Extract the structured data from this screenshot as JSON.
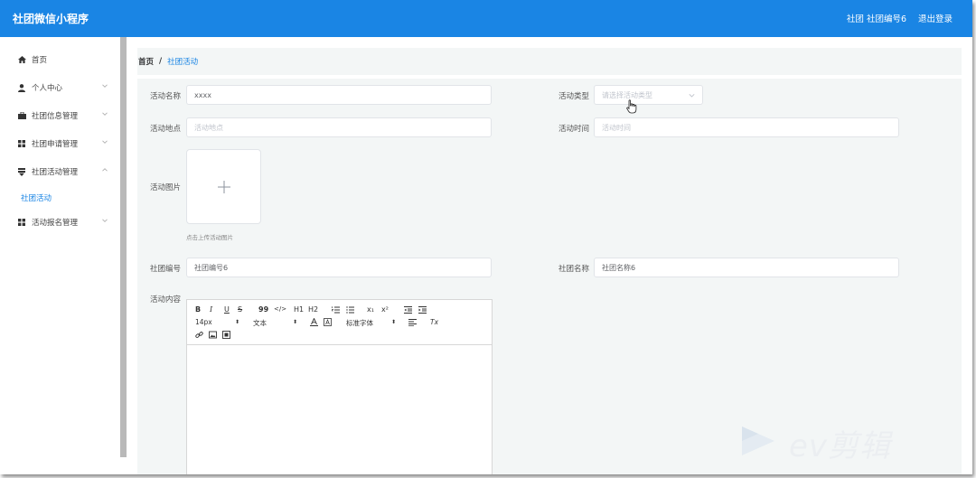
{
  "header": {
    "app_title": "社团微信小程序",
    "user_text": "社团 社团编号6",
    "logout_label": "退出登录"
  },
  "sidebar": {
    "items": [
      {
        "label": "首页",
        "icon": "home-icon",
        "has_chevron": false
      },
      {
        "label": "个人中心",
        "icon": "user-icon",
        "has_chevron": true
      },
      {
        "label": "社团信息管理",
        "icon": "briefcase-icon",
        "has_chevron": true
      },
      {
        "label": "社团申请管理",
        "icon": "grid-icon",
        "has_chevron": true
      },
      {
        "label": "社团活动管理",
        "icon": "funnel-icon",
        "has_chevron": true
      },
      {
        "label": "活动报名管理",
        "icon": "grid-icon",
        "has_chevron": true
      }
    ],
    "sub_item": "社团活动"
  },
  "breadcrumb": {
    "home": "首页",
    "separator": "/",
    "current": "社团活动"
  },
  "form": {
    "name_label": "活动名称",
    "name_value": "xxxx",
    "type_label": "活动类型",
    "type_placeholder": "请选择活动类型",
    "place_label": "活动地点",
    "place_placeholder": "活动地点",
    "time_label": "活动时间",
    "time_placeholder": "活动时间",
    "image_label": "活动图片",
    "upload_hint": "点击上传活动图片",
    "club_no_label": "社团编号",
    "club_no_value": "社团编号6",
    "club_name_label": "社团名称",
    "club_name_value": "社团名称6",
    "content_label": "活动内容"
  },
  "editor": {
    "bold": "B",
    "italic": "I",
    "underline": "U",
    "strike": "S",
    "quote": "99",
    "code": "</>",
    "h1": "H1",
    "h2": "H2",
    "subscript": "x₁",
    "superscript": "x²",
    "font_size": "14px",
    "text_style": "文本",
    "font_family": "标准字体",
    "clear_format": "Tx"
  },
  "watermark": {
    "text": "ev剪辑"
  },
  "colors": {
    "primary": "#1a85e4",
    "panel_bg": "#f3f6f6"
  }
}
